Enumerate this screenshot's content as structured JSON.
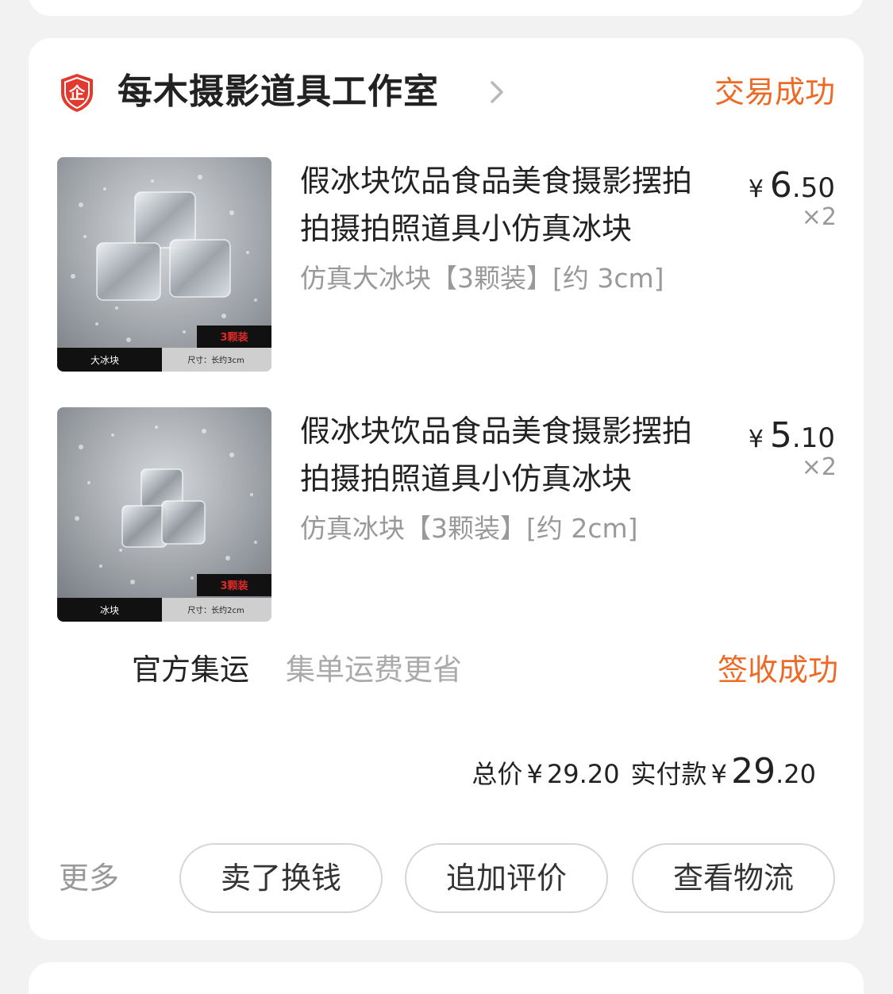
{
  "shop": {
    "name": "每木摄影道具工作室",
    "badge_char": "企",
    "status": "交易成功"
  },
  "items": [
    {
      "title": "假冰块饮品食品美食摄影摆拍拍摄拍照道具小仿真冰块",
      "sku": "仿真大冰块【3颗装】[约 3cm]",
      "price_symbol": "¥",
      "price_int": "6",
      "price_dec": ".50",
      "quantity": "×2",
      "thumb": {
        "tag": "3颗装",
        "label_left": "大冰块",
        "label_right": "尺寸：长约3cm"
      }
    },
    {
      "title": "假冰块饮品食品美食摄影摆拍拍摄拍照道具小仿真冰块",
      "sku": "仿真冰块【3颗装】[约 2cm]",
      "price_symbol": "¥",
      "price_int": "5",
      "price_dec": ".10",
      "quantity": "×2",
      "thumb": {
        "tag": "3颗装",
        "label_left": "冰块",
        "label_right": "尺寸：长约2cm"
      }
    }
  ],
  "shipping": {
    "label": "官方集运",
    "desc": "集单运费更省",
    "status": "签收成功"
  },
  "totals": {
    "total_label": "总价",
    "total_symbol": "¥",
    "total_value": "29.20",
    "paid_label": "实付款",
    "paid_symbol": "¥",
    "paid_int": "29",
    "paid_dec": ".20"
  },
  "actions": {
    "more": "更多",
    "sell": "卖了换钱",
    "review": "追加评价",
    "logistics": "查看物流"
  },
  "colors": {
    "accent": "#ee6a24",
    "shield": "#e23a2e"
  }
}
